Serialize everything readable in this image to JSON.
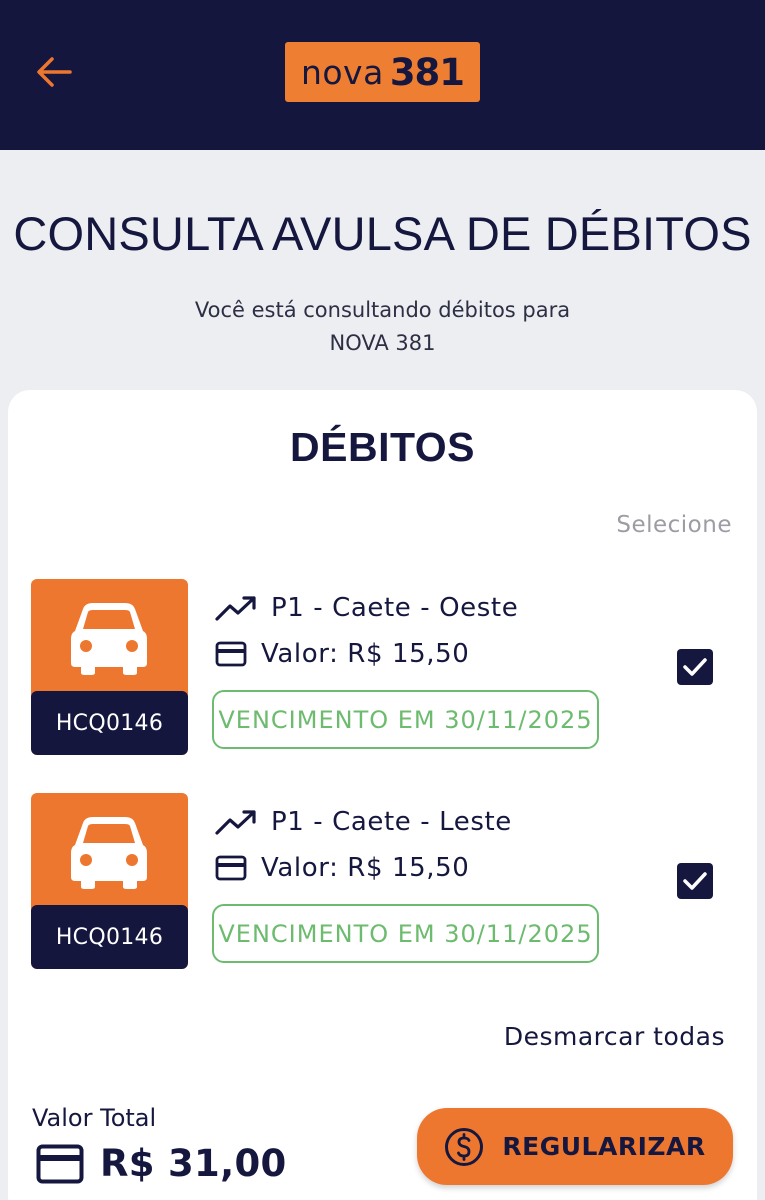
{
  "header": {
    "logo_word": "nova",
    "logo_number": "381"
  },
  "intro": {
    "title": "CONSULTA AVULSA DE DÉBITOS",
    "subtitle_line1": "Você está consultando débitos para",
    "subtitle_line2": "NOVA 381"
  },
  "debits": {
    "title": "DÉBITOS",
    "select_label": "Selecione",
    "items": [
      {
        "plate": "HCQ0146",
        "route": "P1 - Caete - Oeste",
        "value": "Valor: R$ 15,50",
        "due": "VENCIMENTO EM 30/11/2025",
        "checked": true
      },
      {
        "plate": "HCQ0146",
        "route": "P1 - Caete - Leste",
        "value": "Valor: R$ 15,50",
        "due": "VENCIMENTO EM 30/11/2025",
        "checked": true
      }
    ],
    "unselect_all": "Desmarcar todas"
  },
  "footer": {
    "total_label": "Valor Total",
    "total_value": "R$ 31,00",
    "pay_button": "REGULARIZAR"
  },
  "colors": {
    "navy": "#14163e",
    "orange": "#ee7730",
    "green": "#6cbb6e"
  }
}
